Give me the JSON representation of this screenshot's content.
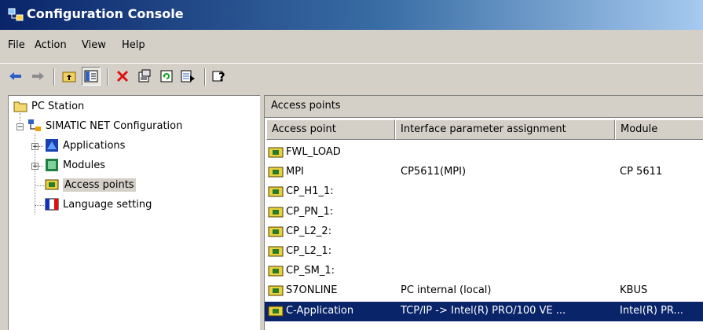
{
  "window": {
    "title": "Configuration Console"
  },
  "menu": [
    {
      "label": "File"
    },
    {
      "label": "Action"
    },
    {
      "label": "View"
    },
    {
      "label": "Help"
    }
  ],
  "toolbar": {
    "icons": [
      "back-arrow-icon",
      "forward-arrow-icon",
      "up-folder-icon",
      "show-tree-icon",
      "delete-icon",
      "properties-icon",
      "refresh-icon",
      "export-list-icon",
      "help-icon"
    ]
  },
  "tree": {
    "items": [
      {
        "label": "PC Station"
      },
      {
        "label": "SIMATIC NET Configuration"
      },
      {
        "label": "Applications"
      },
      {
        "label": "Modules"
      },
      {
        "label": "Access points"
      },
      {
        "label": "Language setting"
      }
    ]
  },
  "panel": {
    "title": "Access points",
    "columns": [
      "Access point",
      "Interface parameter assignment",
      "Module"
    ],
    "rows": [
      {
        "access_point": "FWL_LOAD",
        "assignment": "",
        "module": ""
      },
      {
        "access_point": "MPI",
        "assignment": "CP5611(MPI)",
        "module": "CP 5611"
      },
      {
        "access_point": "CP_H1_1:",
        "assignment": "",
        "module": ""
      },
      {
        "access_point": "CP_PN_1:",
        "assignment": "",
        "module": ""
      },
      {
        "access_point": "CP_L2_2:",
        "assignment": "",
        "module": ""
      },
      {
        "access_point": "CP_L2_1:",
        "assignment": "",
        "module": ""
      },
      {
        "access_point": "CP_SM_1:",
        "assignment": "",
        "module": ""
      },
      {
        "access_point": "S7ONLINE",
        "assignment": "PC internal (local)",
        "module": "KBUS"
      },
      {
        "access_point": "C-Application",
        "assignment": "TCP/IP -> Intel(R) PRO/100 VE ...",
        "module": "Intel(R) PR..."
      }
    ]
  },
  "colors": {
    "selection": "#0a246a",
    "title_start": "#0a246a",
    "face": "#d4d0c8"
  }
}
